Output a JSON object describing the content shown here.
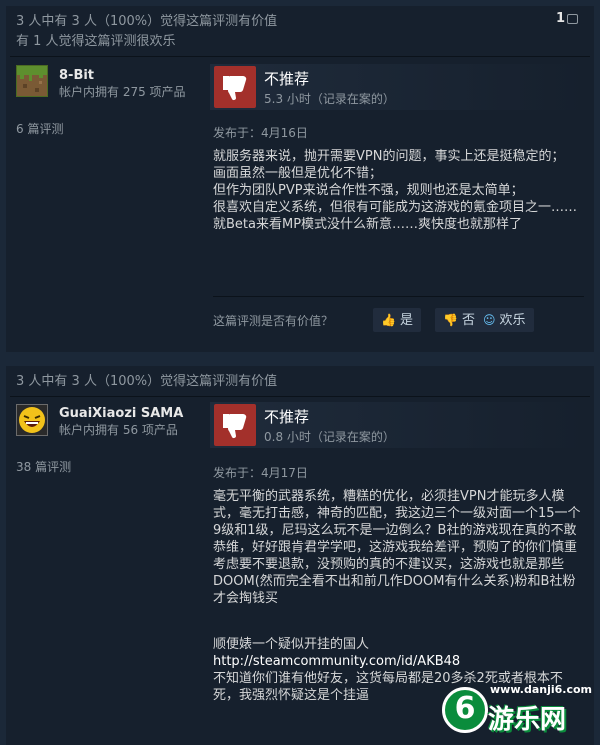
{
  "reviews": [
    {
      "helpful_line": "3 人中有 3 人（100%）觉得这篇评测有价值",
      "funny_line": "有 1 人觉得这篇评测很欢乐",
      "comment_count": "1",
      "author": {
        "name": "8-Bit",
        "owned": "帐户内拥有 275 项产品",
        "review_count": "6 篇评测"
      },
      "recommendation": "不推荐",
      "hours": "5.3 小时（记录在案的）",
      "posted": "发布于：4月16日",
      "content": "就服务器来说，抛开需要VPN的问题，事实上还是挺稳定的；\n画面虽然一般但是优化不错；\n但作为团队PVP来说合作性不强，规则也还是太简单；\n很喜欢自定义系统，但很有可能成为这游戏的氪金项目之一……\n就Beta来看MP模式没什么新意……爽快度也就那样了",
      "vote_question": "这篇评测是否有价值？",
      "vote_yes": "是",
      "vote_no": "否",
      "vote_funny": "欢乐"
    },
    {
      "helpful_line": "3 人中有 3 人（100%）觉得这篇评测有价值",
      "author": {
        "name": "GuaiXiaozi SAMA",
        "owned": "帐户内拥有 56 项产品",
        "review_count": "38 篇评测"
      },
      "recommendation": "不推荐",
      "hours": "0.8 小时（记录在案的）",
      "posted": "发布于：4月17日",
      "content": "毫无平衡的武器系统，糟糕的优化，必须挂VPN才能玩多人模式，毫无打击感，神奇的匹配，我这边三个一级对面一个15一个9级和1级，尼玛这么玩不是一边倒么？B社的游戏现在真的不敢恭维，好好跟肯君学学吧，这游戏我给差评，预购了的你们慎重考虑要不要退款，没预购的真的不建议买，这游戏也就是那些DOOM(然而完全看不出和前几作DOOM有什么关系)粉和B社粉才会掏钱买",
      "content_2": "顺便婊一个疑似开挂的国人",
      "link": "http://steamcommunity.com/id/AKB48",
      "content_3": "不知道你们谁有他好友，这货每局都是20多杀2死或者根本不死，我强烈怀疑这是个挂逼"
    }
  ],
  "watermark": {
    "url": "www.danji6.com",
    "name": "游乐网",
    "logo_char": "6"
  },
  "colors": {
    "background": "#1b2838",
    "panel": "#16202d",
    "thumb_down": "#a3302b",
    "accent": "#67c1f5"
  }
}
